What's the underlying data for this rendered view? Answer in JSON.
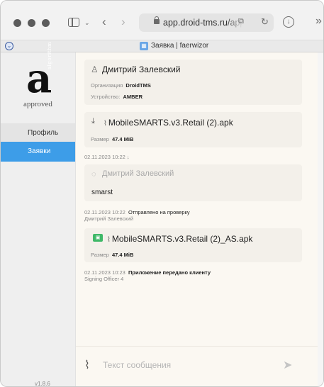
{
  "browser": {
    "url": "app.droid-tms.ru/approv",
    "tab_title": "Заявка | faerwizor"
  },
  "logo": {
    "letter": "a",
    "vertical_text": "algorithm",
    "subtitle": "approved"
  },
  "nav": {
    "items": [
      {
        "label": "Профиль"
      },
      {
        "label": "Заявки"
      }
    ],
    "version": "v1.8.6"
  },
  "user_card": {
    "name": "Дмитрий Залевский",
    "org_label": "Организация",
    "org_value": "DroidTMS",
    "device_label": "Устройство:",
    "device_value": "AMBER"
  },
  "file1": {
    "name": "MobileSMARTS.v3.Retail (2).apk",
    "size_label": "Размер",
    "size_value": "47.4 MiB"
  },
  "event1": {
    "timestamp": "02.11.2023 10:22 ↓"
  },
  "comment": {
    "author": "Дмитрий Залевский",
    "text": "smarst"
  },
  "event2": {
    "timestamp": "02.11.2023 10:22",
    "action": "Отправлено на проверку",
    "author": "Дмитрий Залевский"
  },
  "file2": {
    "name": "MobileSMARTS.v3.Retail (2)_AS.apk",
    "size_label": "Размер",
    "size_value": "47.4 MiB"
  },
  "event3": {
    "timestamp": "02.11.2023 10:23",
    "action": "Приложение передано клиенту",
    "author": "Signing Officer 4"
  },
  "composer": {
    "placeholder": "Текст сообщения"
  }
}
